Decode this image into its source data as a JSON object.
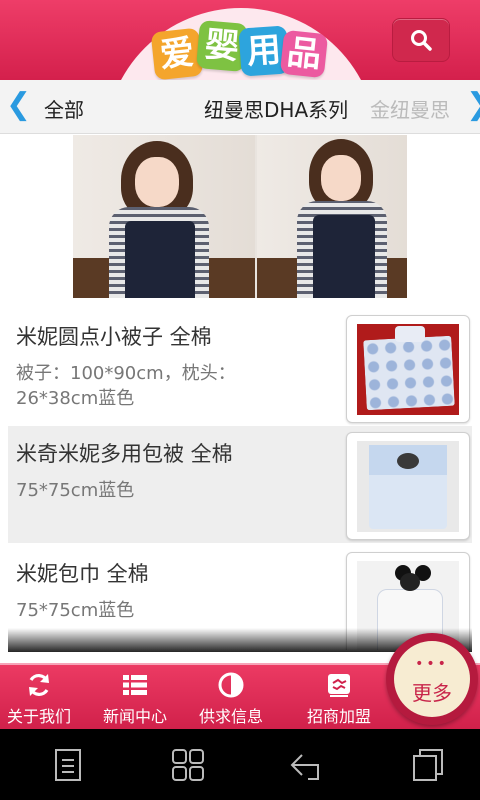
{
  "header": {
    "logo_chars": [
      "爱",
      "婴",
      "用",
      "品"
    ],
    "search_icon": "search-icon"
  },
  "categories": {
    "items": [
      "全部",
      "纽曼思DHA系列",
      "金纽曼思"
    ],
    "left_arrow": "❮",
    "right_arrow": "❯"
  },
  "products": [
    {
      "title": "米妮圆点小被子 全棉",
      "desc": "被子：100*90cm，枕头：26*38cm蓝色"
    },
    {
      "title": "米奇米妮多用包被 全棉",
      "desc": "75*75cm蓝色"
    },
    {
      "title": "米妮包巾 全棉",
      "desc": "75*75cm蓝色"
    }
  ],
  "nav": {
    "items": [
      {
        "label": "关于我们",
        "icon": "refresh-icon"
      },
      {
        "label": "新闻中心",
        "icon": "list-icon"
      },
      {
        "label": "供求信息",
        "icon": "half-circle-icon"
      },
      {
        "label": "招商加盟",
        "icon": "handshake-icon"
      }
    ],
    "more": {
      "dots": "•••",
      "label": "更多"
    }
  },
  "colors": {
    "brand": "#e02a55",
    "accent_blue": "#2a9ae0",
    "more_bg": "#f7ecd2"
  }
}
